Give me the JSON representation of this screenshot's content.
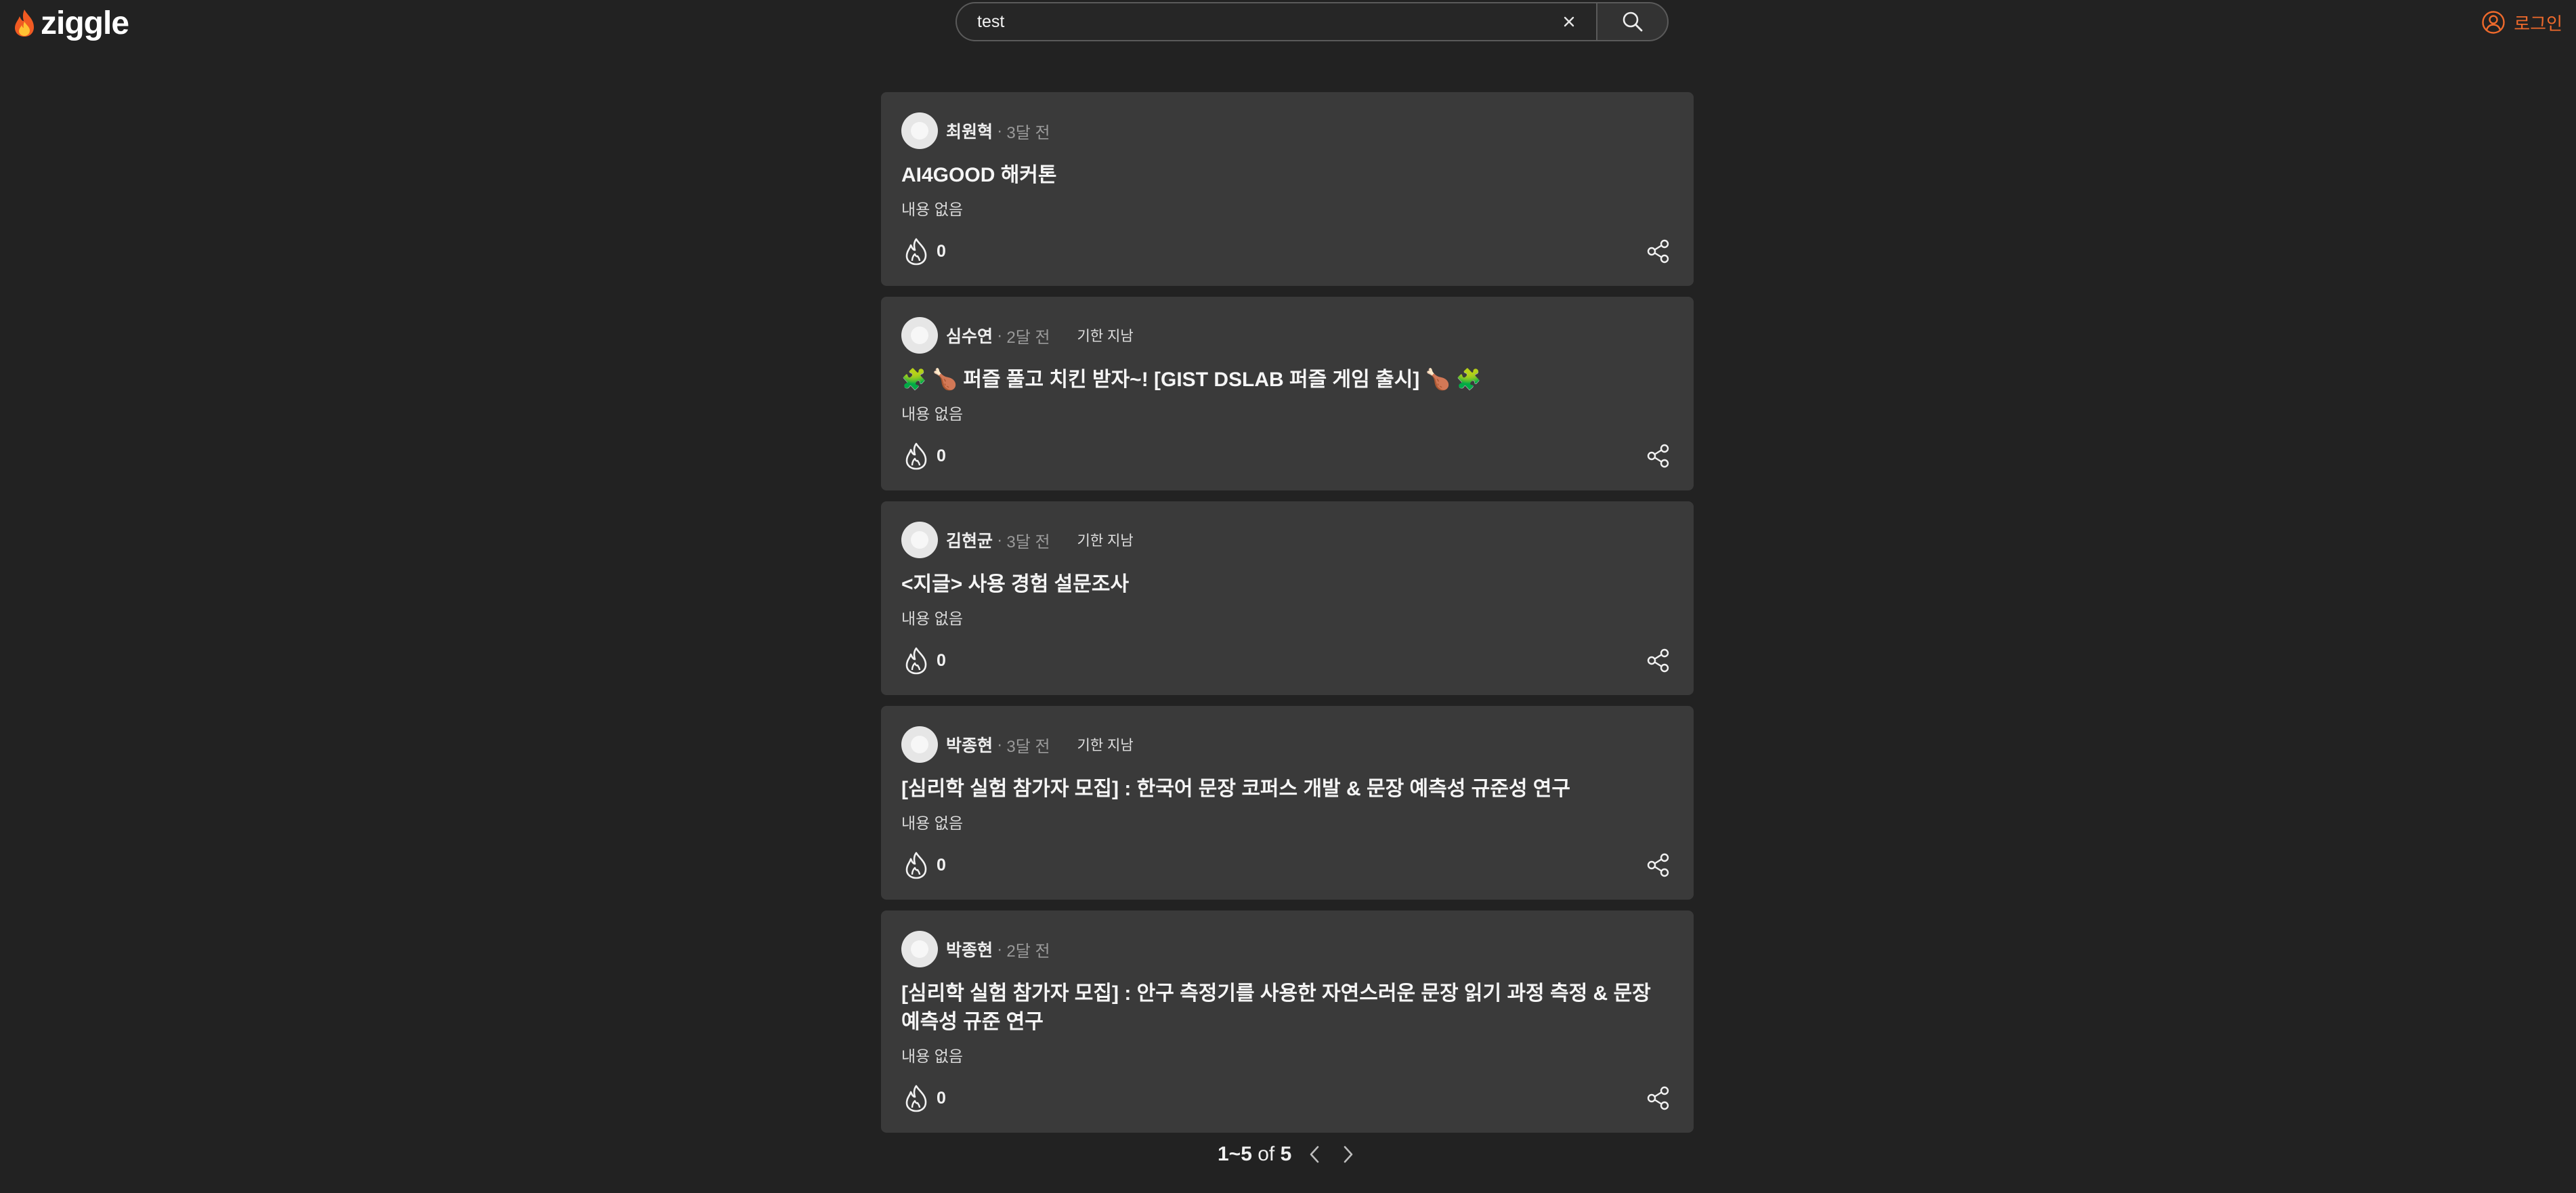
{
  "app": {
    "brand": "ziggle",
    "accent_color": "#ef6a2c"
  },
  "search": {
    "value": "test",
    "clear_symbol": "×",
    "search_icon": "search-icon"
  },
  "header": {
    "login_label": "로그인",
    "login_icon": "user-circle-icon"
  },
  "posts": [
    {
      "author": "최원혁",
      "separator": "·",
      "time": "3달 전",
      "deadline": "",
      "title": "AI4GOOD 해커톤",
      "content": "내용 없음",
      "likes": "0"
    },
    {
      "author": "심수연",
      "separator": "·",
      "time": "2달 전",
      "deadline": "기한 지남",
      "title": "🧩 🍗 퍼즐 풀고 치킨 받자~! [GIST DSLAB 퍼즐 게임 출시] 🍗 🧩",
      "content": "내용 없음",
      "likes": "0"
    },
    {
      "author": "김현균",
      "separator": "·",
      "time": "3달 전",
      "deadline": "기한 지남",
      "title": "<지글> 사용 경험 설문조사",
      "content": "내용 없음",
      "likes": "0"
    },
    {
      "author": "박종현",
      "separator": "·",
      "time": "3달 전",
      "deadline": "기한 지남",
      "title": "[심리학 실험 참가자 모집] : 한국어 문장 코퍼스 개발 & 문장 예측성 규준성 연구",
      "content": "내용 없음",
      "likes": "0"
    },
    {
      "author": "박종현",
      "separator": "·",
      "time": "2달 전",
      "deadline": "",
      "title": "[심리학 실험 참가자 모집] : 안구 측정기를 사용한 자연스러운 문장 읽기 과정 측정 & 문장 예측성 규준 연구",
      "content": "내용 없음",
      "likes": "0"
    }
  ],
  "pagination": {
    "range": "1~5",
    "of_label": "of",
    "total": "5"
  }
}
